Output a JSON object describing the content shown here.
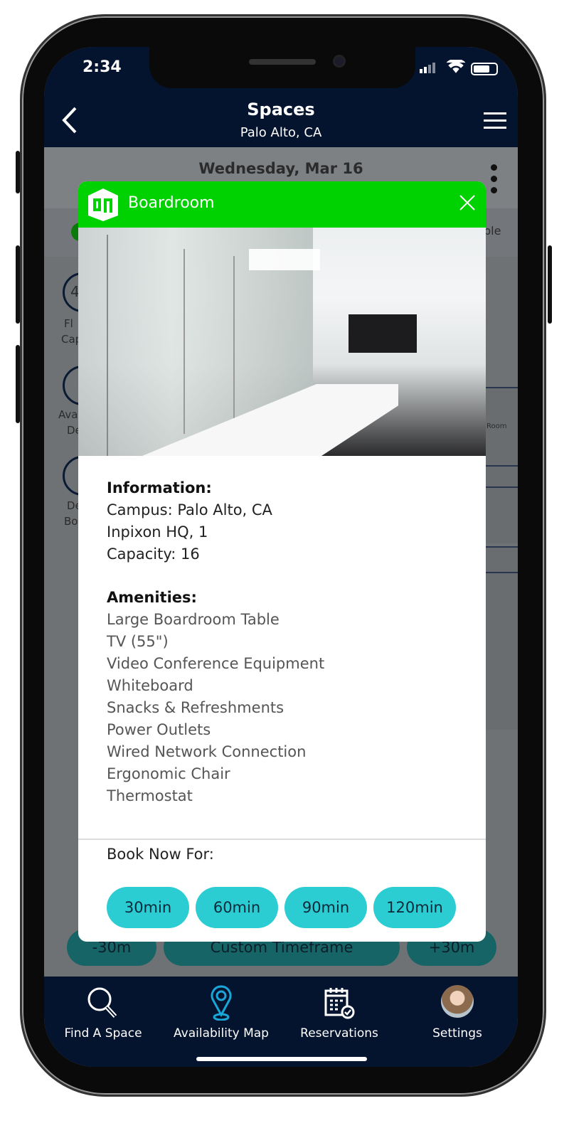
{
  "status_bar": {
    "time": "2:34"
  },
  "header": {
    "title": "Spaces",
    "subtitle": "Palo Alto, CA",
    "back_icon": "chevron-left-icon",
    "menu_icon": "hamburger-icon"
  },
  "date_bar": {
    "date": "Wednesday, Mar 16",
    "more_icon": "kebab-icon"
  },
  "background_fragments": {
    "legend_tail": "ble",
    "circle_1_number": "4",
    "circle_1_label_a": "Fl",
    "circle_1_label_b": "Cap",
    "circle_2_label_a": "Ava",
    "circle_2_label_b": "De",
    "circle_3_label_a": "De",
    "circle_3_label_b": "Bo",
    "room_label": "Room"
  },
  "action_bar": {
    "minus": "-30m",
    "custom": "Custom Timeframe",
    "plus": "+30m"
  },
  "modal": {
    "title": "Boardroom",
    "header_color": "#00d100",
    "information_heading": "Information:",
    "information": [
      "Campus: Palo Alto, CA",
      "Inpixon HQ, 1",
      "Capacity: 16"
    ],
    "amenities_heading": "Amenities:",
    "amenities": [
      "Large Boardroom Table",
      "TV (55\")",
      "Video Conference Equipment",
      "Whiteboard",
      "Snacks & Refreshments",
      "Power Outlets",
      "Wired Network Connection",
      "Ergonomic Chair",
      "Thermostat"
    ],
    "book_label": "Book Now For:",
    "book_options": [
      "30min",
      "60min",
      "90min",
      "120min"
    ],
    "button_color": "#2bccd2"
  },
  "bottom_nav": {
    "items": [
      {
        "label": "Find A Space",
        "icon": "search-icon"
      },
      {
        "label": "Availability Map",
        "icon": "map-pin-icon",
        "active": true
      },
      {
        "label": "Reservations",
        "icon": "calendar-check-icon"
      },
      {
        "label": "Settings",
        "icon": "avatar"
      }
    ],
    "active_color": "#1aa6d8"
  }
}
